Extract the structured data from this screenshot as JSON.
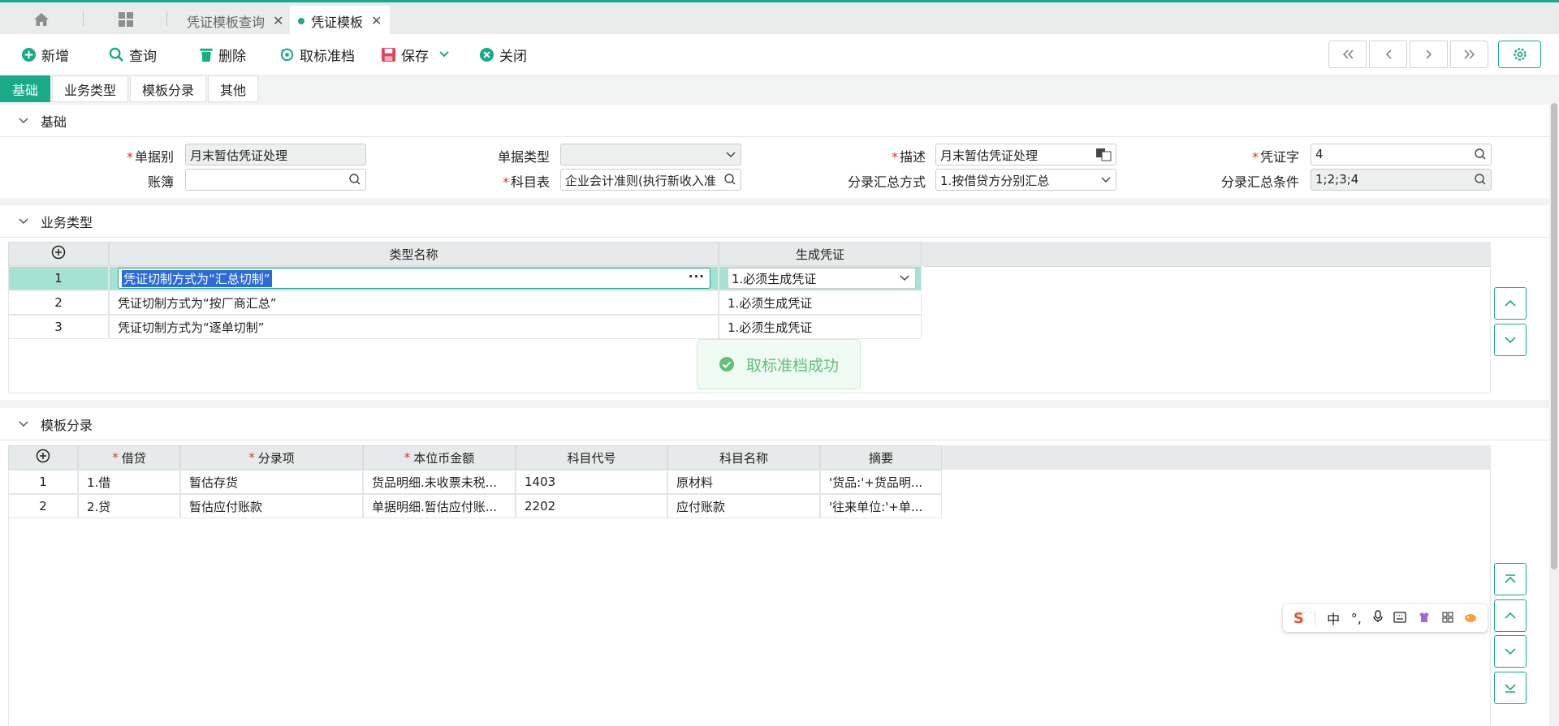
{
  "colors": {
    "accent": "#1aaa88",
    "required": "#e03030",
    "toast": "#5fc27b"
  },
  "tabs": [
    {
      "label": "凭证模板查询",
      "active": false
    },
    {
      "label": "凭证模板",
      "active": true
    }
  ],
  "toolbar": {
    "new": "新增",
    "query": "查询",
    "delete": "删除",
    "unarchive": "取标准档",
    "save": "保存",
    "close": "关闭"
  },
  "subtabs": [
    "基础",
    "业务类型",
    "模板分录",
    "其他"
  ],
  "basic": {
    "title": "基础",
    "fields": {
      "doc_kind": {
        "label": "单据别",
        "value": "月末暂估凭证处理"
      },
      "doc_type": {
        "label": "单据类型",
        "value": ""
      },
      "description": {
        "label": "描述",
        "value": "月末暂估凭证处理"
      },
      "voucher_word": {
        "label": "凭证字",
        "value": "4"
      },
      "ledger": {
        "label": "账簿",
        "value": ""
      },
      "account_chart": {
        "label": "科目表",
        "value": "企业会计准则(执行新收入准"
      },
      "summary_mode": {
        "label": "分录汇总方式",
        "value": "1.按借贷方分别汇总"
      },
      "summary_cond": {
        "label": "分录汇总条件",
        "value": "1;2;3;4"
      }
    }
  },
  "business_types": {
    "title": "业务类型",
    "columns": [
      "类型名称",
      "生成凭证"
    ],
    "rows": [
      {
        "no": "1",
        "name": "凭证切制方式为“汇总切制”",
        "gen": "1.必须生成凭证"
      },
      {
        "no": "2",
        "name": "凭证切制方式为“按厂商汇总”",
        "gen": "1.必须生成凭证"
      },
      {
        "no": "3",
        "name": "凭证切制方式为“逐单切制”",
        "gen": "1.必须生成凭证"
      }
    ]
  },
  "toast": {
    "text": "取标准档成功"
  },
  "entries": {
    "title": "模板分录",
    "columns": [
      "借贷",
      "分录项",
      "本位币金额",
      "科目代号",
      "科目名称",
      "摘要"
    ],
    "rows": [
      {
        "no": "1",
        "dc": "1.借",
        "item": "暂估存货",
        "amount": "货品明细.未收票未税...",
        "code": "1403",
        "name": "原材料",
        "memo": "'货品:'+货品明..."
      },
      {
        "no": "2",
        "dc": "2.贷",
        "item": "暂估应付账款",
        "amount": "单据明细.暂估应付账...",
        "code": "2202",
        "name": "应付账款",
        "memo": "'往来单位:'+单..."
      }
    ]
  },
  "ime": {
    "mode": "中"
  }
}
